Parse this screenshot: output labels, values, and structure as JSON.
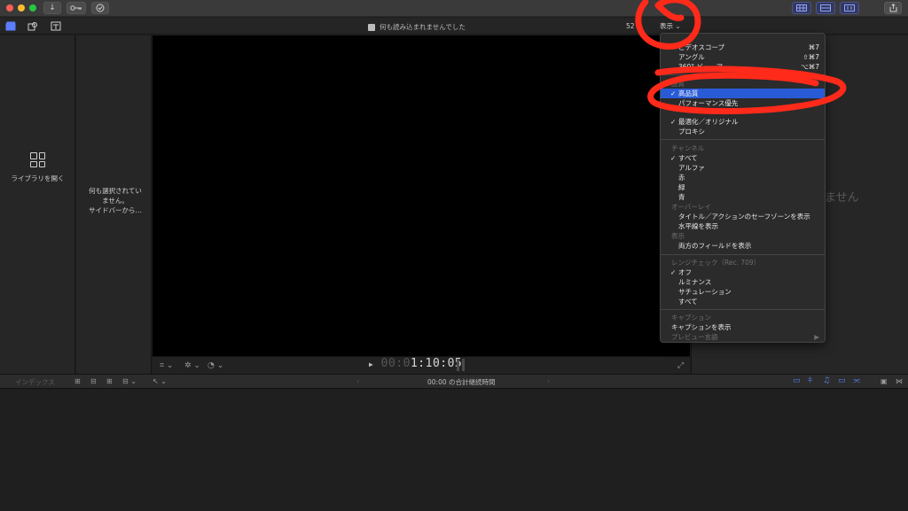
{
  "viewer": {
    "status": "何も読み込まれませんでした",
    "zoom": "52",
    "view_button": "表示",
    "timecode_dim": "00:0",
    "timecode": "1:10:05"
  },
  "library": {
    "open_label": "ライブラリを開く"
  },
  "browser": {
    "message_line1": "何も選択されてい",
    "message_line2": "ません。",
    "message_line3": "サイドバーから…"
  },
  "inspector": {
    "message": "ません"
  },
  "timeline": {
    "index_label": "インデックス",
    "duration": "00:00 の合計継続時間"
  },
  "menu": {
    "items": {
      "videoscope": {
        "label": "ビデオスコープ",
        "shortcut": "⌘7"
      },
      "angle": {
        "label": "アングル",
        "shortcut": "⇧⌘7"
      },
      "viewer360": {
        "label": "360° ビューア",
        "shortcut": "⌥⌘7"
      },
      "quality_header": "品質",
      "high_quality": "高品質",
      "performance": "パフォーマンス優先",
      "optimized": "最適化／オリジナル",
      "proxy": "プロキシ",
      "channel_header": "チャンネル",
      "all": "すべて",
      "alpha": "アルファ",
      "red": "赤",
      "green": "緑",
      "blue": "青",
      "overlay_header": "オーバーレイ",
      "safe_zone": "タイトル／アクションのセーフゾーンを表示",
      "horizon": "水平線を表示",
      "display_header": "表示",
      "both_fields": "両方のフィールドを表示",
      "range_header": "レンジチェック（Rec. 709）",
      "off": "オフ",
      "luminance": "ルミナンス",
      "saturation": "サチュレーション",
      "range_all": "すべて",
      "caption_header": "キャプション",
      "show_caption": "キャプションを表示",
      "preview_lang": "プレビュー言語"
    }
  },
  "colors": {
    "selection": "#2a5bd7",
    "annotation": "#ff2a1a",
    "accent_blue": "#5b7dff"
  }
}
